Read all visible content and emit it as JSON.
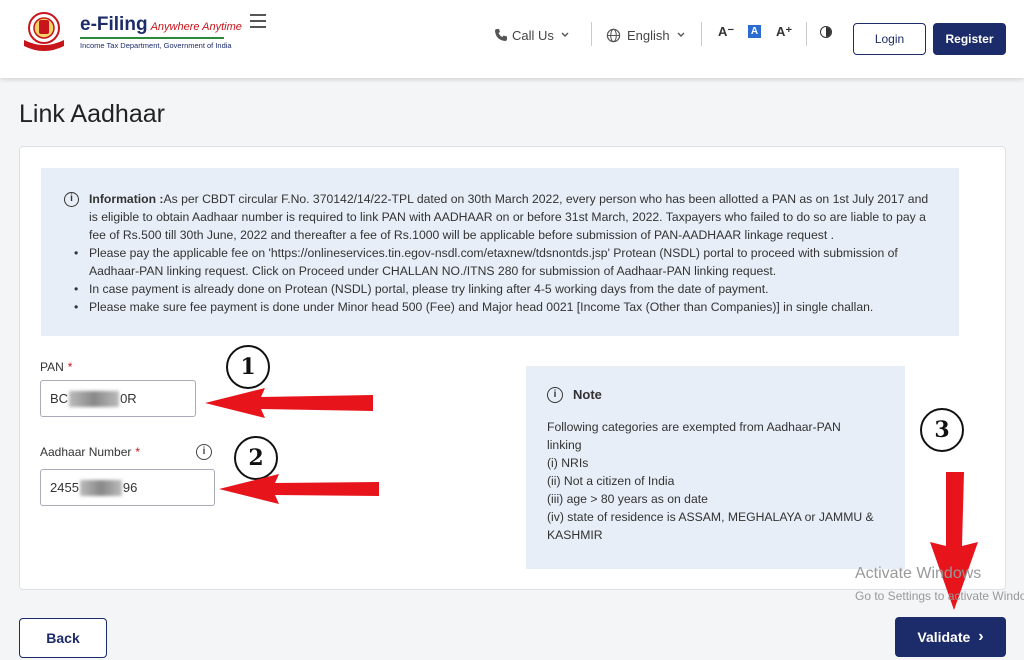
{
  "header": {
    "brand_title": "e-Filing",
    "brand_tagline": "Anywhere Anytime",
    "brand_subtitle": "Income Tax Department, Government of India",
    "call_us": "Call Us",
    "language": "English",
    "font_decrease": "A⁻",
    "font_default": "A",
    "font_increase": "A⁺",
    "login": "Login",
    "register": "Register"
  },
  "page": {
    "title": "Link Aadhaar"
  },
  "info": {
    "lead_bold": "Information :",
    "lead_text": "As per CBDT circular F.No. 370142/14/22-TPL dated on 30th March 2022, every person who has been allotted a PAN as on 1st July 2017 and is eligible to obtain Aadhaar number is required to link PAN with AADHAAR on or before 31st March, 2022. Taxpayers who failed to do so are liable to pay a fee of Rs.500 till 30th June, 2022 and thereafter a fee of Rs.1000 will be applicable before submission of PAN-AADHAAR linkage request .",
    "bullets": [
      "Please pay the applicable fee on 'https://onlineservices.tin.egov-nsdl.com/etaxnew/tdsnontds.jsp' Protean (NSDL) portal to proceed with submission of Aadhaar-PAN linking request. Click on Proceed under CHALLAN NO./ITNS 280 for submission of Aadhaar-PAN linking request.",
      "In case payment is already done on Protean (NSDL) portal, please try linking after 4-5 working days from the date of payment.",
      "Please make sure fee payment is done under Minor head 500 (Fee) and Major head 0021 [Income Tax (Other than Companies)] in single challan."
    ]
  },
  "form": {
    "pan_label": "PAN",
    "pan_value_start": "BC",
    "pan_value_end": "0R",
    "aadhaar_label": "Aadhaar Number",
    "aadhaar_value_start": "2455",
    "aadhaar_value_end": "96",
    "required_mark": "*"
  },
  "note": {
    "title": "Note",
    "lines": [
      "Following categories are exempted from Aadhaar-PAN",
      "linking",
      "(i) NRIs",
      "(ii) Not a citizen of India",
      "(iii) age > 80 years as on date",
      "(iv) state of residence is ASSAM, MEGHALAYA or JAMMU &",
      "KASHMIR"
    ]
  },
  "annotations": {
    "step1": "1",
    "step2": "2",
    "step3": "3",
    "arrow_color": "#e8141b"
  },
  "footer": {
    "back": "Back",
    "validate": "Validate",
    "validate_chevron": "›"
  },
  "watermark": {
    "line1": "Activate Windows",
    "line2": "Go to Settings to activate Windows."
  },
  "colors": {
    "primary": "#1c2c6b",
    "info_bg": "#e8eef7",
    "required": "#c8151b"
  }
}
